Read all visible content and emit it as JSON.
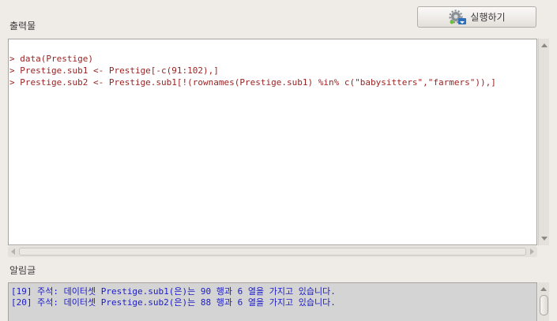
{
  "toolbar": {
    "run_label": "실행하기",
    "run_icon": "gear-run-icon"
  },
  "output": {
    "label": "출력물",
    "lines": [
      "> data(Prestige)",
      "> Prestige.sub1 <- Prestige[-c(91:102),]",
      "> Prestige.sub2 <- Prestige.sub1[!(rownames(Prestige.sub1) %in% c(\"babysitters\",\"farmers\")),]"
    ],
    "text_color": "#9a1f1f"
  },
  "notices": {
    "label": "알림글",
    "lines": [
      "[19] 주석: 데이터셋 Prestige.sub1(은)는 90 행과 6 열을 가지고 있습니다.",
      "[20] 주석: 데이터셋 Prestige.sub2(은)는 88 행과 6 열을 가지고 있습니다."
    ],
    "text_color": "#1c1cc8"
  }
}
